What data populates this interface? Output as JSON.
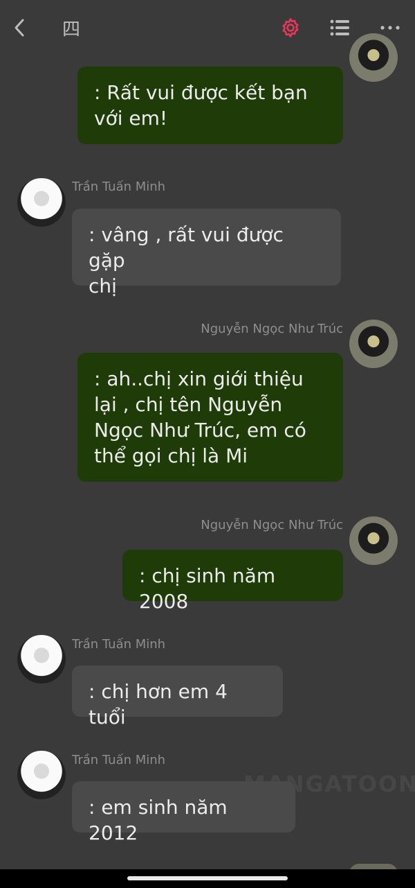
{
  "topbar": {
    "chapter_glyph": "四"
  },
  "messages": [
    {
      "sender": "",
      "text": ": Rất vui được kết bạn\nvới em!"
    },
    {
      "sender": "Trần Tuấn Minh",
      "text": ": vâng , rất vui được gặp\nchị"
    },
    {
      "sender": "Nguyễn Ngọc Như Trúc",
      "text": ": ah..chị xin giới thiệu\nlại , chị tên Nguyễn\nNgọc Như Trúc, em có\nthể gọi chị là Mi"
    },
    {
      "sender": "Nguyễn Ngọc Như Trúc",
      "text": ": chị sinh năm 2008"
    },
    {
      "sender": "Trần Tuấn Minh",
      "text": ": chị hơn em 4 tuổi"
    },
    {
      "sender": "Trần Tuấn Minh",
      "text": ": em sinh năm 2012"
    }
  ],
  "watermark": "MANGATOON",
  "colors": {
    "outgoing_bubble": "#1f3b08",
    "incoming_bubble": "#4a4a4a",
    "background": "#3a3a3a",
    "accent": "#e8375a"
  }
}
